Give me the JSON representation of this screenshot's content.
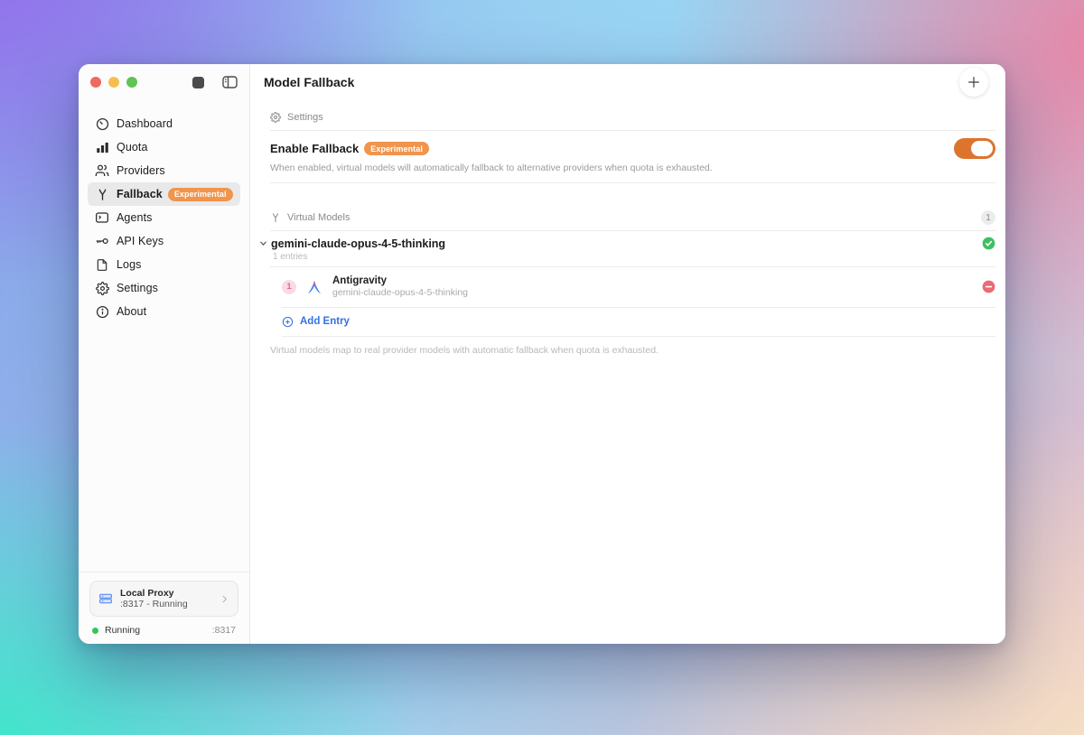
{
  "window": {
    "title": "Model Fallback"
  },
  "sidebar": {
    "items": [
      {
        "label": "Dashboard",
        "icon": "gauge-icon"
      },
      {
        "label": "Quota",
        "icon": "bar-chart-icon"
      },
      {
        "label": "Providers",
        "icon": "users-icon"
      },
      {
        "label": "Fallback",
        "icon": "fork-icon",
        "badge": "Experimental",
        "active": true
      },
      {
        "label": "Agents",
        "icon": "terminal-window-icon"
      },
      {
        "label": "API Keys",
        "icon": "key-icon"
      },
      {
        "label": "Logs",
        "icon": "document-icon"
      },
      {
        "label": "Settings",
        "icon": "gear-icon"
      },
      {
        "label": "About",
        "icon": "info-icon"
      }
    ],
    "proxy_card": {
      "title": "Local Proxy",
      "subtitle": ":8317 - Running"
    },
    "status": {
      "label": "Running",
      "port": ":8317"
    }
  },
  "main": {
    "settings_section": {
      "header": "Settings",
      "enable_fallback": {
        "label": "Enable Fallback",
        "badge": "Experimental",
        "enabled": true,
        "description": "When enabled, virtual models will automatically fallback to alternative providers when quota is exhausted."
      }
    },
    "virtual_models_section": {
      "header": "Virtual Models",
      "count": "1",
      "models": [
        {
          "name": "gemini-claude-opus-4-5-thinking",
          "entries_label": "1 entries",
          "enabled": true,
          "entries": [
            {
              "index": "1",
              "provider": "Antigravity",
              "model": "gemini-claude-opus-4-5-thinking"
            }
          ]
        }
      ],
      "add_entry_label": "Add Entry",
      "footer": "Virtual models map to real provider models with automatic fallback when quota is exhausted."
    }
  },
  "colors": {
    "accent_orange": "#e8833c",
    "toggle_orange": "#dd742e",
    "link_blue": "#3472e4",
    "status_green": "#34c759",
    "check_green": "#3fbf63",
    "remove_red": "#ea6a75",
    "pink_badge_bg": "#f9dbe2",
    "pink_badge_text": "#d96c85",
    "proxy_icon_blue": "#5b8def"
  }
}
